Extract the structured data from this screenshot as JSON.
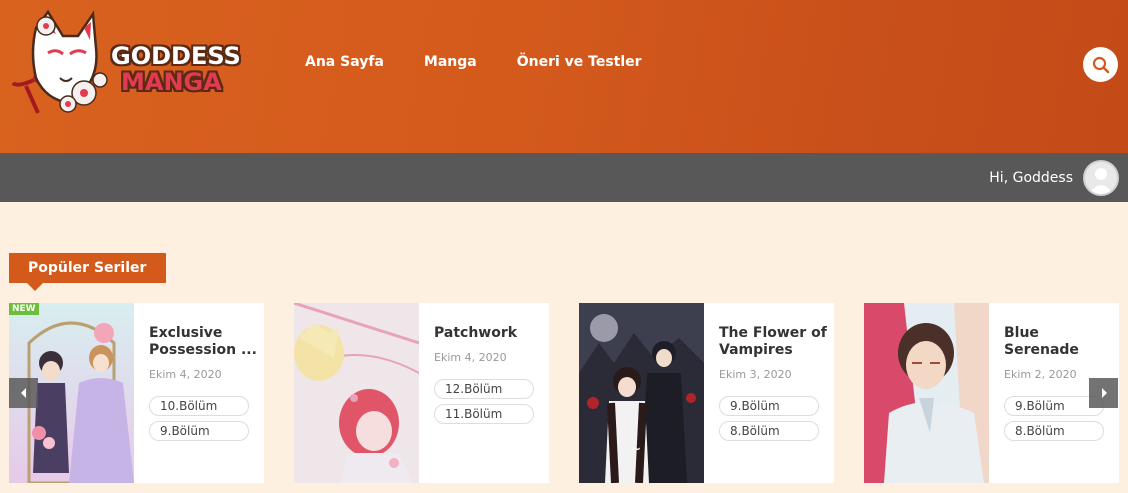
{
  "brand": {
    "line1": "GODDESS",
    "line2": "MANGA"
  },
  "nav": {
    "items": [
      "Ana Sayfa",
      "Manga",
      "Öneri ve Testler"
    ]
  },
  "user": {
    "greeting": "Hi, Goddess"
  },
  "section": {
    "title": "Popüler Seriler"
  },
  "cards": [
    {
      "title": "Exclusive Possession ...",
      "date": "Ekim 4, 2020",
      "chapters": [
        "10.Bölüm",
        "9.Bölüm"
      ],
      "badge": "NEW"
    },
    {
      "title": "Patchwork",
      "date": "Ekim 4, 2020",
      "chapters": [
        "12.Bölüm",
        "11.Bölüm"
      ]
    },
    {
      "title": "The Flower of Vampires",
      "date": "Ekim 3, 2020",
      "chapters": [
        "9.Bölüm",
        "8.Bölüm"
      ]
    },
    {
      "title": "Blue Serenade",
      "date": "Ekim 2, 2020",
      "chapters": [
        "9.Bölüm",
        "8.Bölüm"
      ]
    }
  ],
  "icons": {
    "search": "search-icon",
    "avatar": "user-avatar-icon",
    "prev": "chevron-left-icon",
    "next": "chevron-right-icon"
  },
  "colors": {
    "header": "#d45a1c",
    "userbar": "#585858",
    "background": "#fdf0e0",
    "accent": "#d45a1c"
  }
}
